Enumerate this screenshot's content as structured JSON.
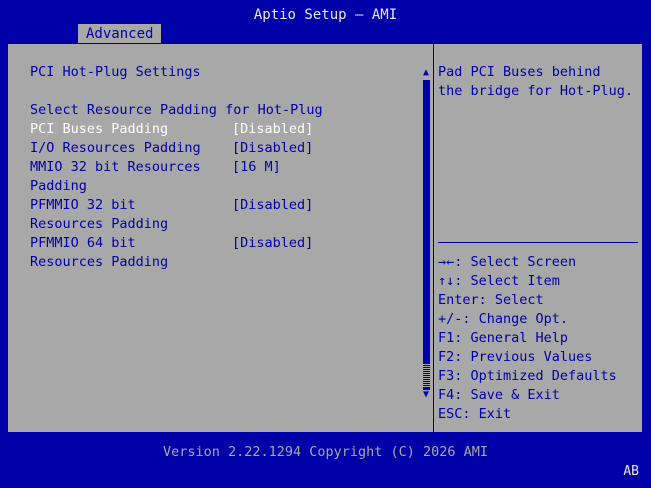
{
  "header": {
    "title": "Aptio Setup – AMI"
  },
  "tabs": [
    {
      "label": "Advanced"
    }
  ],
  "main": {
    "section_title": "PCI Hot-Plug Settings",
    "subtitle": "Select Resource Padding for Hot-Plug",
    "settings": [
      {
        "label": "PCI Buses Padding",
        "value": "[Disabled]"
      },
      {
        "label": "I/O Resources Padding",
        "value": "[Disabled]"
      },
      {
        "label_line1": "MMIO 32 bit Resources",
        "label_line2": "Padding",
        "value": "[16 M]"
      },
      {
        "label_line1": "PFMMIO 32 bit",
        "label_line2": "Resources Padding",
        "value": "[Disabled]"
      },
      {
        "label_line1": "PFMMIO 64 bit",
        "label_line2": "Resources Padding",
        "value": "[Disabled]"
      }
    ]
  },
  "help": {
    "description_line1": "Pad PCI Buses behind",
    "description_line2": "the bridge for Hot-Plug.",
    "keys": [
      {
        "key": "→←",
        "text": ": Select Screen"
      },
      {
        "key": "↑↓",
        "text": ": Select Item"
      },
      {
        "key": "",
        "text": "Enter: Select"
      },
      {
        "key": "",
        "text": "+/-: Change Opt."
      },
      {
        "key": "",
        "text": "F1: General Help"
      },
      {
        "key": "",
        "text": "F2: Previous Values"
      },
      {
        "key": "",
        "text": "F3: Optimized Defaults"
      },
      {
        "key": "",
        "text": "F4: Save & Exit"
      },
      {
        "key": "",
        "text": "ESC: Exit"
      }
    ]
  },
  "footer": {
    "version": "Version 2.22.1294 Copyright (C) 2026 AMI"
  },
  "corner": {
    "label": "AB"
  },
  "icons": {
    "scroll_up": "scroll-up-arrow-icon",
    "scroll_down": "scroll-down-arrow-icon"
  },
  "colors": {
    "background": "#0000a8",
    "panel": "#a8a8a8",
    "selected": "#ffffff",
    "text": "#0000a8"
  }
}
